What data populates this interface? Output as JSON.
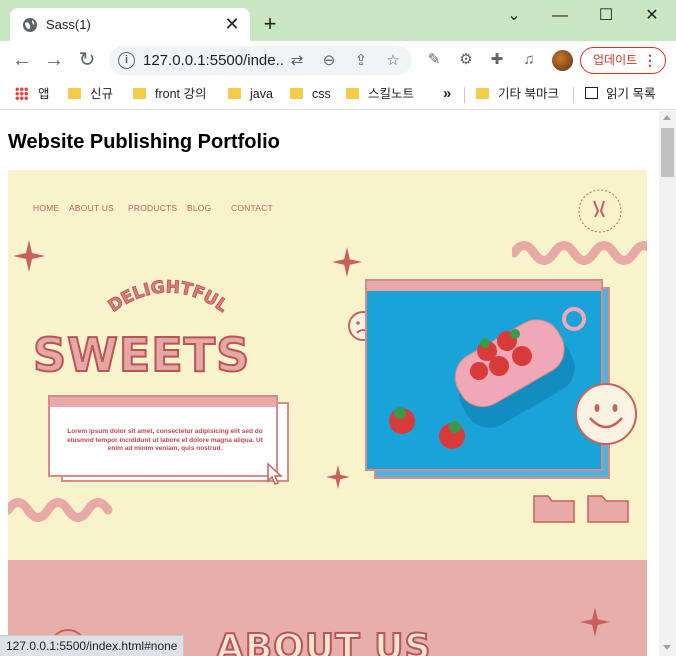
{
  "tab": {
    "title": "Sass(1)",
    "close": "✕"
  },
  "new_tab": "+",
  "window": {
    "chevron": "⌄",
    "minimize": "—",
    "maximize": "☐",
    "close": "✕"
  },
  "toolbar": {
    "url": "127.0.0.1:5500/inde...",
    "update_label": "업데이트",
    "update_dots": "⋮"
  },
  "bookmarks": {
    "apps": "앱",
    "items": [
      "신규",
      "front 강의",
      "java",
      "css",
      "스킬노트"
    ],
    "overflow": "»",
    "other": "기타 북마크",
    "reading_list": "읽기 목록"
  },
  "page": {
    "title": "Website Publishing Portfolio"
  },
  "hero": {
    "nav": [
      "HOME",
      "ABOUT US",
      "PRODUCTS",
      "BLOG",
      "CONTACT"
    ],
    "arc_text": "DELIGHTFUL",
    "headline": "SWEETS",
    "lorem": "Lorem ipsum dolor sit amet, consectetur adipisicing elit sed do eiusmod tempor incididunt ut labore et dolore magna aliqua. Ut enim ad minim veniam, quis nostrud.",
    "badge_text": "DELIGHTFUL SWEETS",
    "next_section_title": "ABOUT US"
  },
  "status_bar": "127.0.0.1:5500/index.html#none",
  "colors": {
    "titlebar": "#c9e7c1",
    "hero_bg": "#f8f3ca",
    "accent_pink": "#e8aeaa",
    "accent_red": "#b9545a",
    "photo_blue": "#1aa3d8"
  }
}
